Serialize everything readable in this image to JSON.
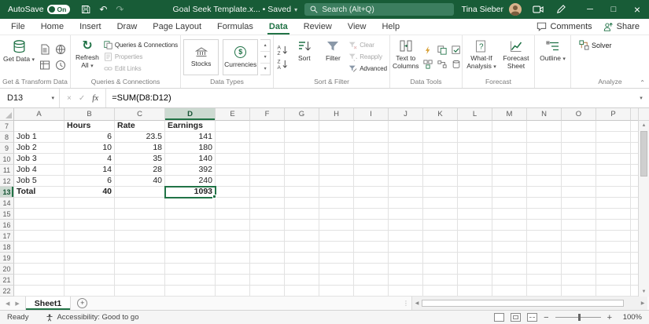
{
  "title_bar": {
    "autosave": "AutoSave",
    "autosave_state": "On",
    "title_full": "Goal Seek Template.x... • Saved",
    "search": "Search (Alt+Q)",
    "user": "Tina Sieber"
  },
  "icons": {
    "undo": "↶",
    "redo": "↷",
    "refresh": "↻",
    "chevron_down": "▾",
    "chevron_up": "▴",
    "collapse": "⌃",
    "minimize": "─",
    "maximize": "□",
    "close": "×",
    "cancel": "×",
    "enter": "✓",
    "nav_left": "◀",
    "nav_right": "▶",
    "add_sheet": "+",
    "splitter": "⋮",
    "scroll_up": "▲",
    "scroll_down": "▼",
    "zoom_out": "−",
    "zoom_in": "+",
    "dollar": "$",
    "gallery_more": "▾"
  },
  "ribbon": {
    "tabs": [
      "File",
      "Home",
      "Insert",
      "Draw",
      "Page Layout",
      "Formulas",
      "Data",
      "Review",
      "View",
      "Help"
    ],
    "active_tab": "Data",
    "comments_label": "Comments",
    "share_label": "Share",
    "get_transform": {
      "label": "Get & Transform Data",
      "get_data": "Get Data"
    },
    "queries": {
      "label": "Queries & Connections",
      "refresh_all": "Refresh All",
      "queries_connections": "Queries & Connections",
      "properties": "Properties",
      "edit_links": "Edit Links"
    },
    "data_types": {
      "label": "Data Types",
      "stocks": "Stocks",
      "currencies": "Currencies"
    },
    "sort_filter": {
      "label": "Sort & Filter",
      "sort": "Sort",
      "filter": "Filter",
      "clear": "Clear",
      "reapply": "Reapply",
      "advanced": "Advanced"
    },
    "data_tools": {
      "label": "Data Tools",
      "text_to_columns": "Text to Columns"
    },
    "forecast": {
      "label": "Forecast",
      "what_if": "What-If Analysis",
      "forecast_sheet": "Forecast Sheet"
    },
    "outline": {
      "label": "Outline"
    },
    "analyze": {
      "label": "Analyze",
      "solver": "Solver"
    }
  },
  "formula_bar": {
    "name_box": "D13",
    "fx": "fx",
    "formula": "=SUM(D8:D12)"
  },
  "grid": {
    "column_headers": [
      "A",
      "B",
      "C",
      "D",
      "E",
      "F",
      "G",
      "H",
      "I",
      "J",
      "K",
      "L",
      "M",
      "N",
      "O",
      "P"
    ],
    "selection": {
      "col": "D",
      "row": 13
    },
    "rows": [
      {
        "num": 7,
        "values": [
          "",
          "Hours",
          "Rate",
          "Earnings"
        ],
        "bold": true
      },
      {
        "num": 8,
        "values": [
          "Job 1",
          "6",
          "23.5",
          "141"
        ]
      },
      {
        "num": 9,
        "values": [
          "Job 2",
          "10",
          "18",
          "180"
        ]
      },
      {
        "num": 10,
        "values": [
          "Job 3",
          "4",
          "35",
          "140"
        ]
      },
      {
        "num": 11,
        "values": [
          "Job 4",
          "14",
          "28",
          "392"
        ]
      },
      {
        "num": 12,
        "values": [
          "Job 5",
          "6",
          "40",
          "240"
        ]
      },
      {
        "num": 13,
        "values": [
          "Total",
          "40",
          "",
          "1093"
        ],
        "bold": true
      },
      {
        "num": 14
      },
      {
        "num": 15
      },
      {
        "num": 16
      },
      {
        "num": 17
      },
      {
        "num": 18
      },
      {
        "num": 19
      },
      {
        "num": 20
      },
      {
        "num": 21
      },
      {
        "num": 22
      }
    ]
  },
  "sheet_bar": {
    "sheet_tab": "Sheet1"
  },
  "status_bar": {
    "ready": "Ready",
    "accessibility": "Accessibility: Good to go",
    "zoom": "100%"
  }
}
